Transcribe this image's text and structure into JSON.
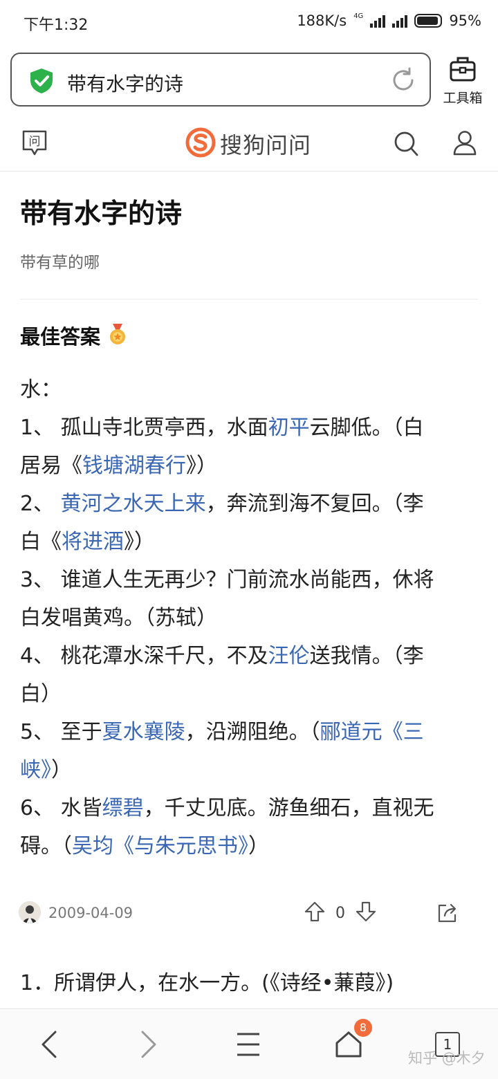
{
  "status_bar": {
    "time": "下午1:32",
    "net_speed": "188K/s",
    "net_type": "4G",
    "battery": "95%"
  },
  "address_bar": {
    "query": "带有水字的诗",
    "shield_icon": "shield-check-icon",
    "reload_icon": "reload-icon"
  },
  "toolbox": {
    "label": "工具箱"
  },
  "site_header": {
    "left_icon_label": "问",
    "logo_text": "搜狗问问",
    "brand_color": "#f26b3a"
  },
  "question": {
    "title": "带有水字的诗",
    "subtitle": "带有草的哪"
  },
  "best_answer": {
    "label": "最佳答案",
    "intro": "水：",
    "lines": [
      {
        "segments": [
          {
            "t": "1、 孤山寺北贾亭西，水面",
            "link": false
          },
          {
            "t": "初平",
            "link": true
          },
          {
            "t": "云脚低。（白",
            "link": false
          }
        ]
      },
      {
        "segments": [
          {
            "t": "居易《",
            "link": false
          },
          {
            "t": "钱塘湖春行",
            "link": true
          },
          {
            "t": "》）",
            "link": false
          }
        ]
      },
      {
        "segments": [
          {
            "t": "2、 ",
            "link": false
          },
          {
            "t": "黄河之水天上来",
            "link": true
          },
          {
            "t": "，奔流到海不复回。（李",
            "link": false
          }
        ]
      },
      {
        "segments": [
          {
            "t": "白《",
            "link": false
          },
          {
            "t": "将进酒",
            "link": true
          },
          {
            "t": "》）",
            "link": false
          }
        ]
      },
      {
        "segments": [
          {
            "t": "3、 谁道人生无再少？门前流水尚能西，休将",
            "link": false
          }
        ]
      },
      {
        "segments": [
          {
            "t": "白发唱黄鸡。（苏轼）",
            "link": false
          }
        ]
      },
      {
        "segments": [
          {
            "t": "4、 桃花潭水深千尺，不及",
            "link": false
          },
          {
            "t": "汪伦",
            "link": true
          },
          {
            "t": "送我情。（李",
            "link": false
          }
        ]
      },
      {
        "segments": [
          {
            "t": "白）",
            "link": false
          }
        ]
      },
      {
        "segments": [
          {
            "t": "5、 至于",
            "link": false
          },
          {
            "t": "夏水襄陵",
            "link": true
          },
          {
            "t": "，沿溯阻绝。（",
            "link": false
          },
          {
            "t": "郦道元《三",
            "link": true
          }
        ]
      },
      {
        "segments": [
          {
            "t": "峡》",
            "link": true
          },
          {
            "t": "）",
            "link": false
          }
        ]
      },
      {
        "segments": [
          {
            "t": "6、 水皆",
            "link": false
          },
          {
            "t": "缥碧",
            "link": true
          },
          {
            "t": "，千丈见底。游鱼细石，直视无",
            "link": false
          }
        ]
      },
      {
        "segments": [
          {
            "t": "碍。（",
            "link": false
          },
          {
            "t": "吴均《与朱元思书》",
            "link": true
          },
          {
            "t": "）",
            "link": false
          }
        ]
      }
    ],
    "date": "2009-04-09",
    "vote_count": "0"
  },
  "next_answer": {
    "text": "1．所谓伊人，在水一方。(《诗经•蒹葭》)"
  },
  "bottom_nav": {
    "home_badge": "8",
    "tab_count": "1"
  },
  "watermark": "知乎 @木夕",
  "colors": {
    "link": "#3a67b3",
    "shield": "#2db14b",
    "badge": "#f26b3a"
  }
}
